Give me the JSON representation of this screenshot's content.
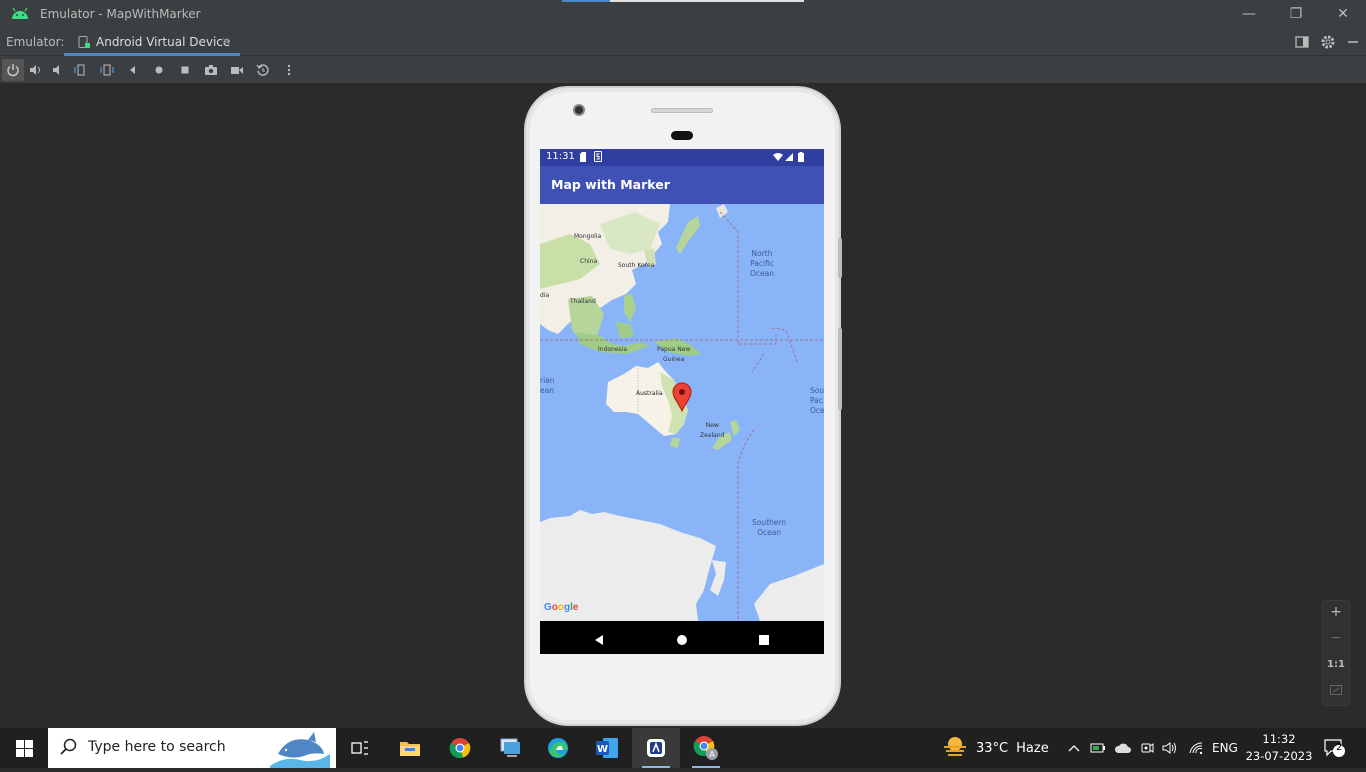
{
  "window": {
    "title": "Emulator - MapWithMarker",
    "minimize": "—",
    "restore": "❐",
    "close": "✕"
  },
  "tabbar": {
    "label": "Emulator:",
    "tab_label": "Android Virtual Device",
    "tab_close": "✕"
  },
  "toolbar": {
    "buttons": [
      "power-icon",
      "volume-up-icon",
      "volume-down-icon",
      "rotate-left-icon",
      "rotate-right-icon",
      "back-icon",
      "home-icon",
      "overview-icon",
      "camera-icon",
      "screenrecord-icon",
      "snapshot-icon",
      "more-icon"
    ]
  },
  "device": {
    "status_time": "11:31",
    "app_title": "Map with Marker",
    "map": {
      "labels": {
        "mongolia": "Mongolia",
        "china": "China",
        "south_korea": "South Korea",
        "thailand": "Thailand",
        "indonesia": "Indonesia",
        "papua": "Papua New\nGuinea",
        "australia": "Australia",
        "new_zealand": "New\nZealand",
        "north_pacific": "North\nPacific\nOcean",
        "indian_ocean": "rian\nean",
        "south_pacific": "Sou\nPac\nOce",
        "southern_ocean": "Southern\nOcean",
        "india_edge": "dia"
      },
      "google": "Google",
      "marker": "red-map-marker"
    }
  },
  "zoom": {
    "plus": "+",
    "minus": "−",
    "one_to_one": "1:1"
  },
  "taskbar": {
    "search_placeholder": "Type here to search",
    "weather_temp": "33°C",
    "weather_text": "Haze",
    "lang": "ENG",
    "time": "11:32",
    "date": "23-07-2023",
    "notifications": "2"
  }
}
